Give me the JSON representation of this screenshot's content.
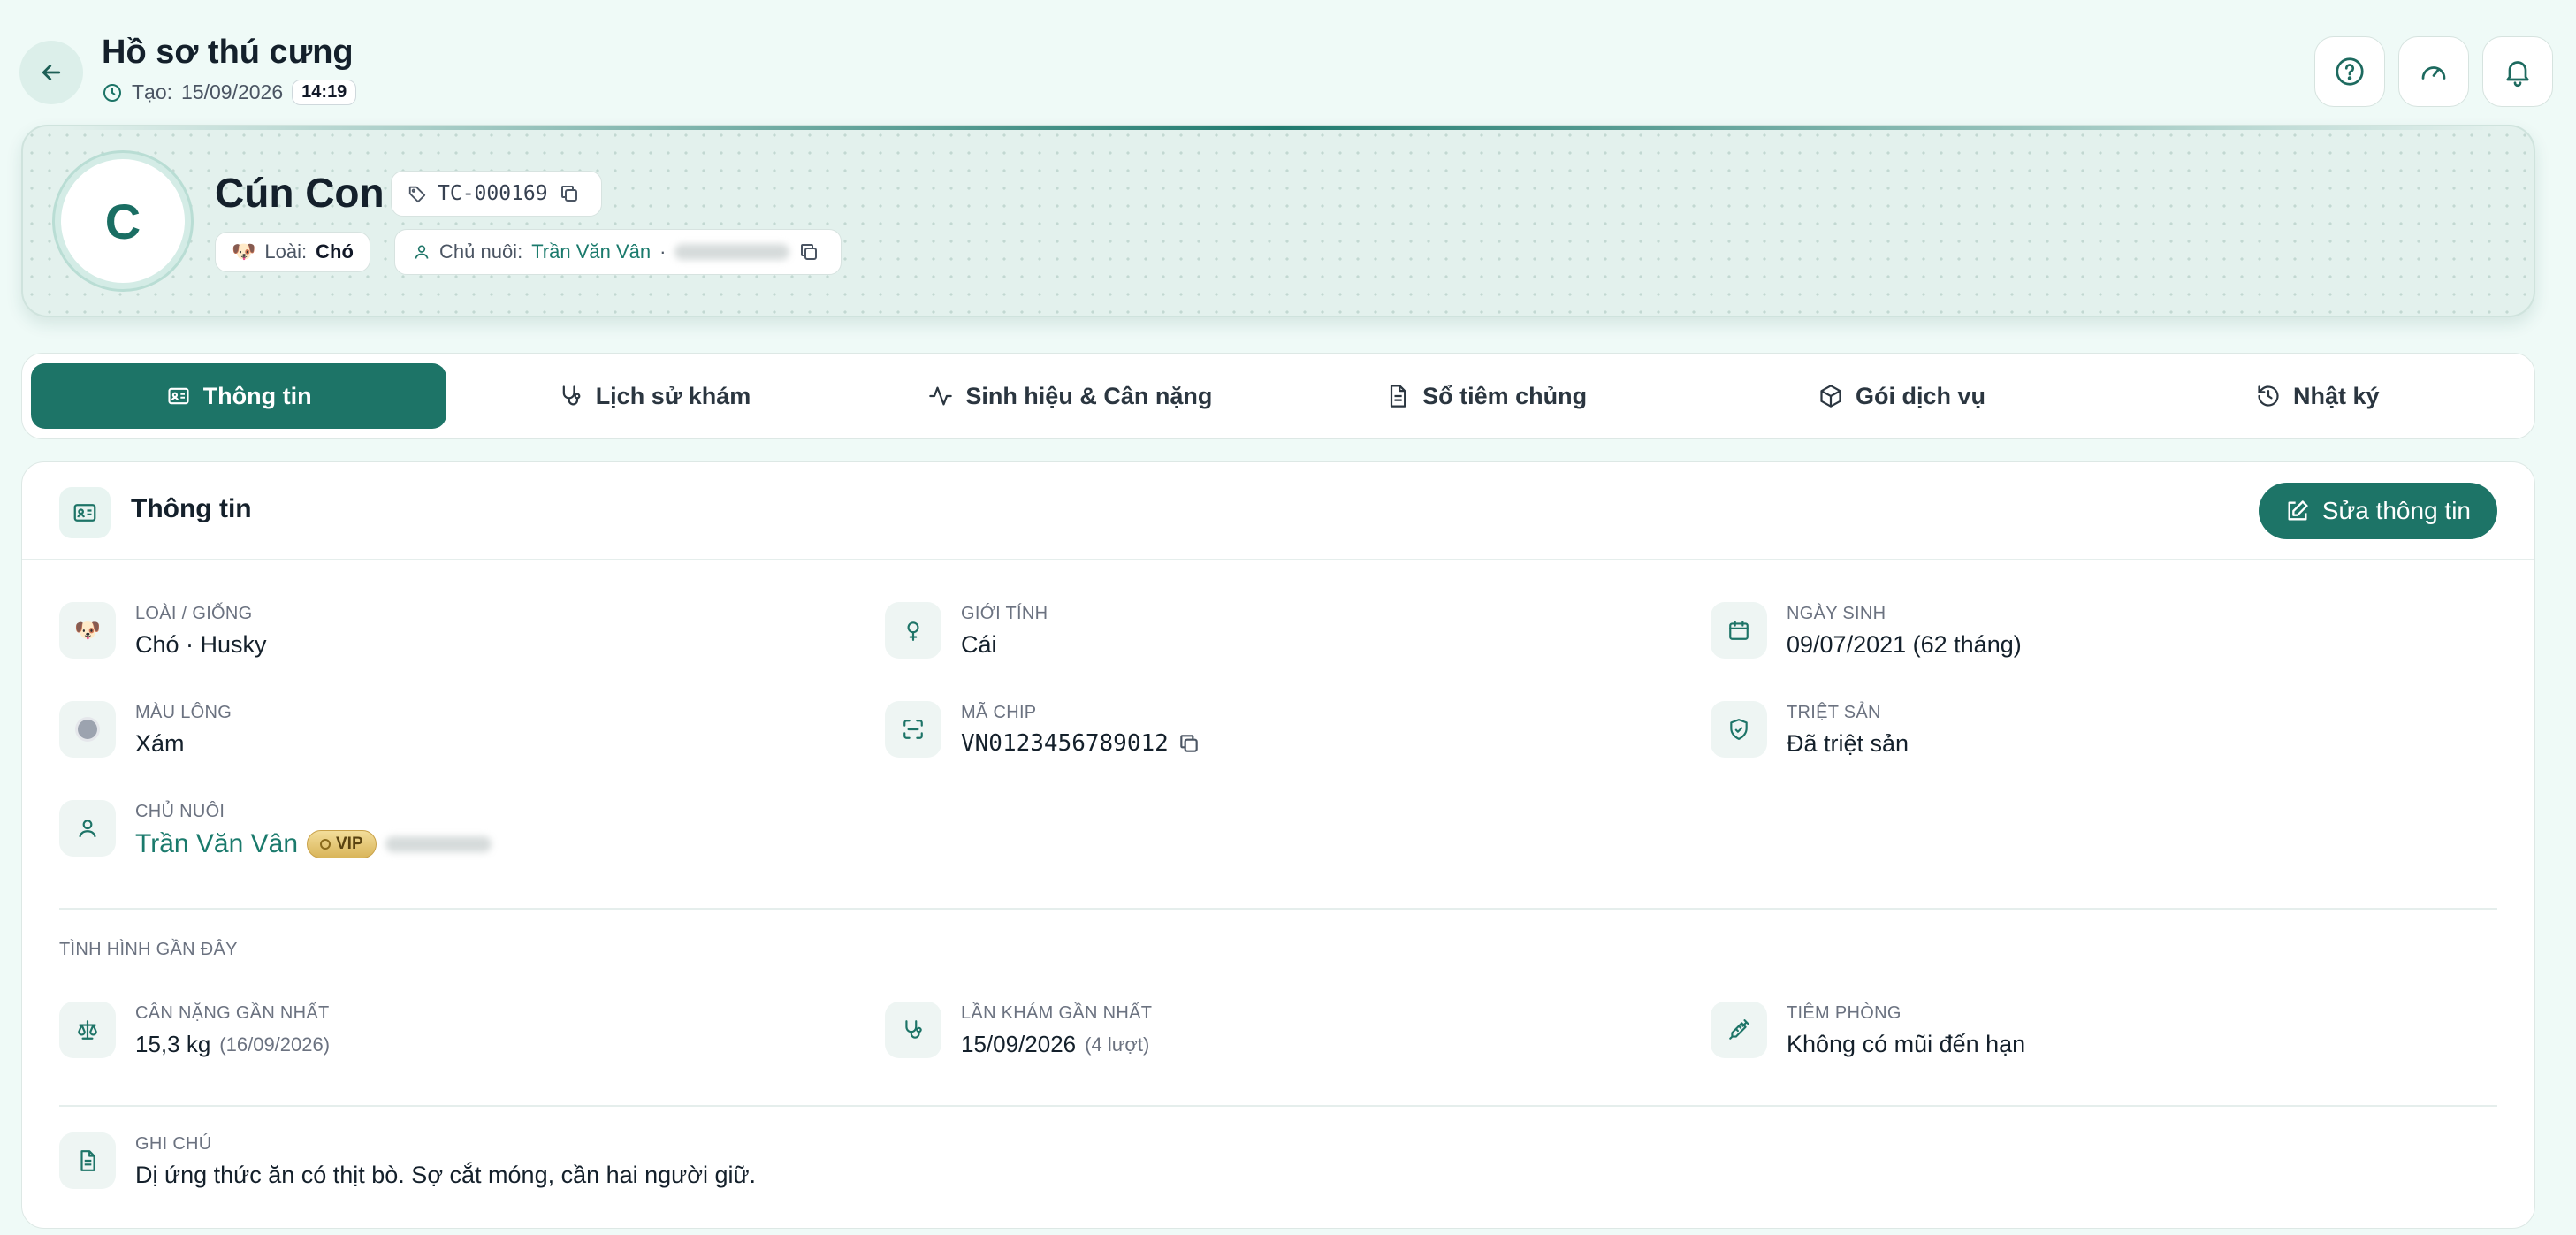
{
  "header": {
    "title": "Hồ sơ thú cưng",
    "created_label": "Tạo:",
    "created_date": "15/09/2026",
    "created_time": "14:19"
  },
  "hero": {
    "avatar_letter": "C",
    "pet_name": "Cún Con",
    "code": "TC-000169",
    "species_label": "Loài:",
    "species_value": "Chó",
    "species_emoji": "🐶",
    "owner_label": "Chủ nuôi:",
    "owner_name": "Trần Văn Vân",
    "owner_separator": "·"
  },
  "tabs": [
    {
      "label": "Thông tin",
      "icon": "id-card-icon",
      "active": true
    },
    {
      "label": "Lịch sử khám",
      "icon": "stethoscope-icon",
      "active": false
    },
    {
      "label": "Sinh hiệu & Cân nặng",
      "icon": "activity-icon",
      "active": false
    },
    {
      "label": "Sổ tiêm chủng",
      "icon": "document-icon",
      "active": false
    },
    {
      "label": "Gói dịch vụ",
      "icon": "package-icon",
      "active": false
    },
    {
      "label": "Nhật ký",
      "icon": "history-icon",
      "active": false
    }
  ],
  "info": {
    "title": "Thông tin",
    "edit_label": "Sửa thông tin",
    "fields": {
      "breed": {
        "label": "LOÀI / GIỐNG",
        "value": "Chó · Husky",
        "emoji": "🐶"
      },
      "gender": {
        "label": "GIỚI TÍNH",
        "value": "Cái"
      },
      "birthday": {
        "label": "NGÀY SINH",
        "value": "09/07/2021 (62 tháng)"
      },
      "coat": {
        "label": "MÀU LÔNG",
        "value": "Xám",
        "color": "#9ca3af"
      },
      "chip": {
        "label": "MÃ CHIP",
        "value": "VN0123456789012"
      },
      "neutered": {
        "label": "TRIỆT SẢN",
        "value": "Đã triệt sản"
      },
      "owner": {
        "label": "CHỦ NUÔI",
        "value": "Trần Văn Vân",
        "badge": "VIP"
      }
    },
    "recent_section": "TÌNH HÌNH GẦN ĐÂY",
    "recent": {
      "weight": {
        "label": "CÂN NẶNG GẦN NHẤT",
        "value": "15,3 kg",
        "sub": "(16/09/2026)"
      },
      "visit": {
        "label": "LẦN KHÁM GẦN NHẤT",
        "value": "15/09/2026",
        "sub": "(4 lượt)"
      },
      "vaccine": {
        "label": "TIÊM PHÒNG",
        "value": "Không có mũi đến hạn"
      }
    },
    "note": {
      "label": "GHI CHÚ",
      "value": "Dị ứng thức ăn có thịt bò. Sợ cắt móng, cần hai người giữ."
    }
  },
  "colors": {
    "primary": "#1d7467",
    "background": "#effaf7",
    "vip_gold": "#d9b55a"
  }
}
